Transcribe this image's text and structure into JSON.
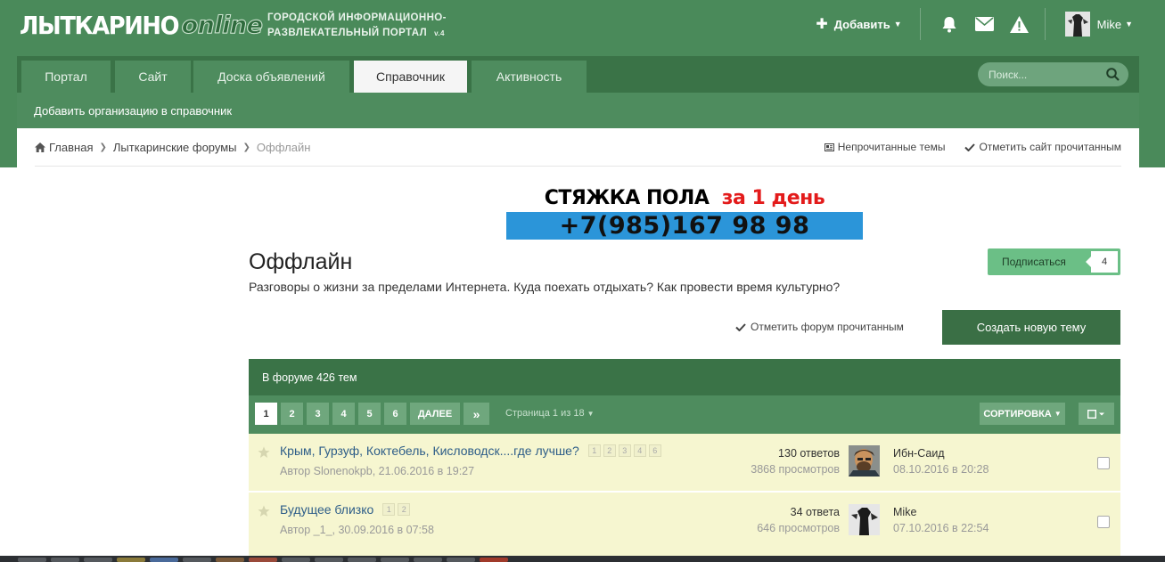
{
  "header": {
    "logo_main": "ЛЫТКАРИНО",
    "logo_online": "online",
    "tagline_line1": "ГОРОДСКОЙ ИНФОРМАЦИОННО-",
    "tagline_line2": "РАЗВЛЕКАТЕЛЬНЫЙ ПОРТАЛ",
    "version": "v.4",
    "add_label": "Добавить",
    "username": "Mike"
  },
  "nav": {
    "tabs": [
      {
        "label": "Портал"
      },
      {
        "label": "Сайт"
      },
      {
        "label": "Доска объявлений"
      },
      {
        "label": "Справочник"
      },
      {
        "label": "Активность"
      }
    ],
    "search_placeholder": "Поиск...",
    "subnav_link": "Добавить организацию в справочник"
  },
  "breadcrumb": {
    "home": "Главная",
    "forums": "Лыткаринские форумы",
    "current": "Оффлайн",
    "unread": "Непрочитанные темы",
    "mark_site_read": "Отметить сайт прочитанным"
  },
  "banner": {
    "line1": "СТЯЖКА ПОЛА",
    "line1_red": "за 1 день",
    "phone": "+7(985)167 98 98"
  },
  "forum": {
    "title": "Оффлайн",
    "description": "Разговоры о жизни за пределами Интернета. Куда поехать отдыхать? Как провести время культурно?",
    "follow_label": "Подписаться",
    "follow_count": "4",
    "mark_forum_read": "Отметить форум прочитанным",
    "new_topic": "Создать новую тему",
    "topic_count_label": "В форуме 426 тем"
  },
  "pagination": {
    "pages": [
      "1",
      "2",
      "3",
      "4",
      "5",
      "6"
    ],
    "next_label": "ДАЛЕЕ",
    "last_label": "»",
    "page_info": "Страница 1 из 18",
    "sort_label": "СОРТИРОВКА"
  },
  "topics": [
    {
      "title": "Крым, Гурзуф, Коктебель, Кисловодск....где лучше?",
      "mini_pages": [
        "1",
        "2",
        "3",
        "4",
        "6"
      ],
      "author": "Автор Slonenokpb, 21.06.2016 в 19:27",
      "replies": "130 ответов",
      "views": "3868 просмотров",
      "last_user": "Ибн-Саид",
      "last_date": "08.10.2016 в 20:28"
    },
    {
      "title": "Будущее близко",
      "mini_pages": [
        "1",
        "2"
      ],
      "author": "Автор _1_, 30.09.2016 в 07:58",
      "replies": "34 ответа",
      "views": "646 просмотров",
      "last_user": "Mike",
      "last_date": "07.10.2016 в 22:54"
    }
  ],
  "colors": {
    "header_green": "#4a8a5a",
    "nav_dark": "#3a7347",
    "button_dark": "#3a6f45",
    "follow_green": "#6bbf86",
    "row_bg": "#f6f6d0",
    "link_blue": "#2d5d88",
    "banner_blue": "#2b95d9",
    "banner_red": "#e31b1b"
  },
  "icons": [
    "plus-icon",
    "bell-icon",
    "envelope-icon",
    "warning-icon",
    "search-icon",
    "home-icon",
    "check-icon",
    "star-icon",
    "checkbox-icon"
  ]
}
